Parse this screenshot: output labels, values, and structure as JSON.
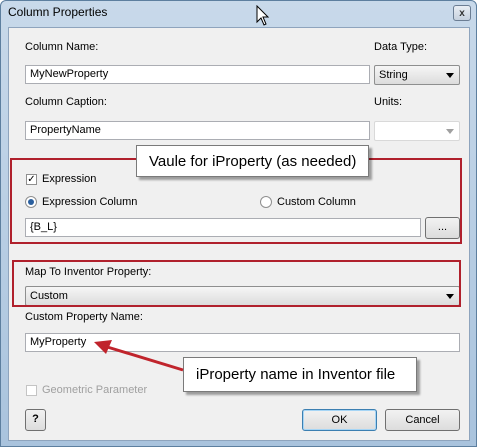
{
  "window": {
    "title": "Column Properties",
    "close_glyph": "x"
  },
  "fields": {
    "column_name_label": "Column Name:",
    "column_name_value": "MyNewProperty",
    "data_type_label": "Data Type:",
    "data_type_value": "String",
    "column_caption_label": "Column Caption:",
    "column_caption_value": "PropertyName",
    "units_label": "Units:",
    "units_value": ""
  },
  "expression": {
    "checkbox_label": "Expression",
    "checked": true,
    "radio_expression_column": "Expression Column",
    "radio_custom_column": "Custom Column",
    "selected_radio": "Expression Column",
    "value": "{B_L}",
    "browse_label": "..."
  },
  "mapping": {
    "label": "Map To Inventor Property:",
    "value": "Custom",
    "custom_name_label": "Custom Property Name:",
    "custom_name_value": "MyProperty"
  },
  "geometric": {
    "label": "Geometric Parameter",
    "checked": false
  },
  "buttons": {
    "help_glyph": "?",
    "ok": "OK",
    "cancel": "Cancel"
  },
  "annotations": {
    "callout_top": "Vaule for iProperty (as needed)",
    "callout_bottom": "iProperty name in Inventor file"
  },
  "colors": {
    "annotation_red": "#b0202c",
    "titlebar": "#c8d9ea"
  }
}
